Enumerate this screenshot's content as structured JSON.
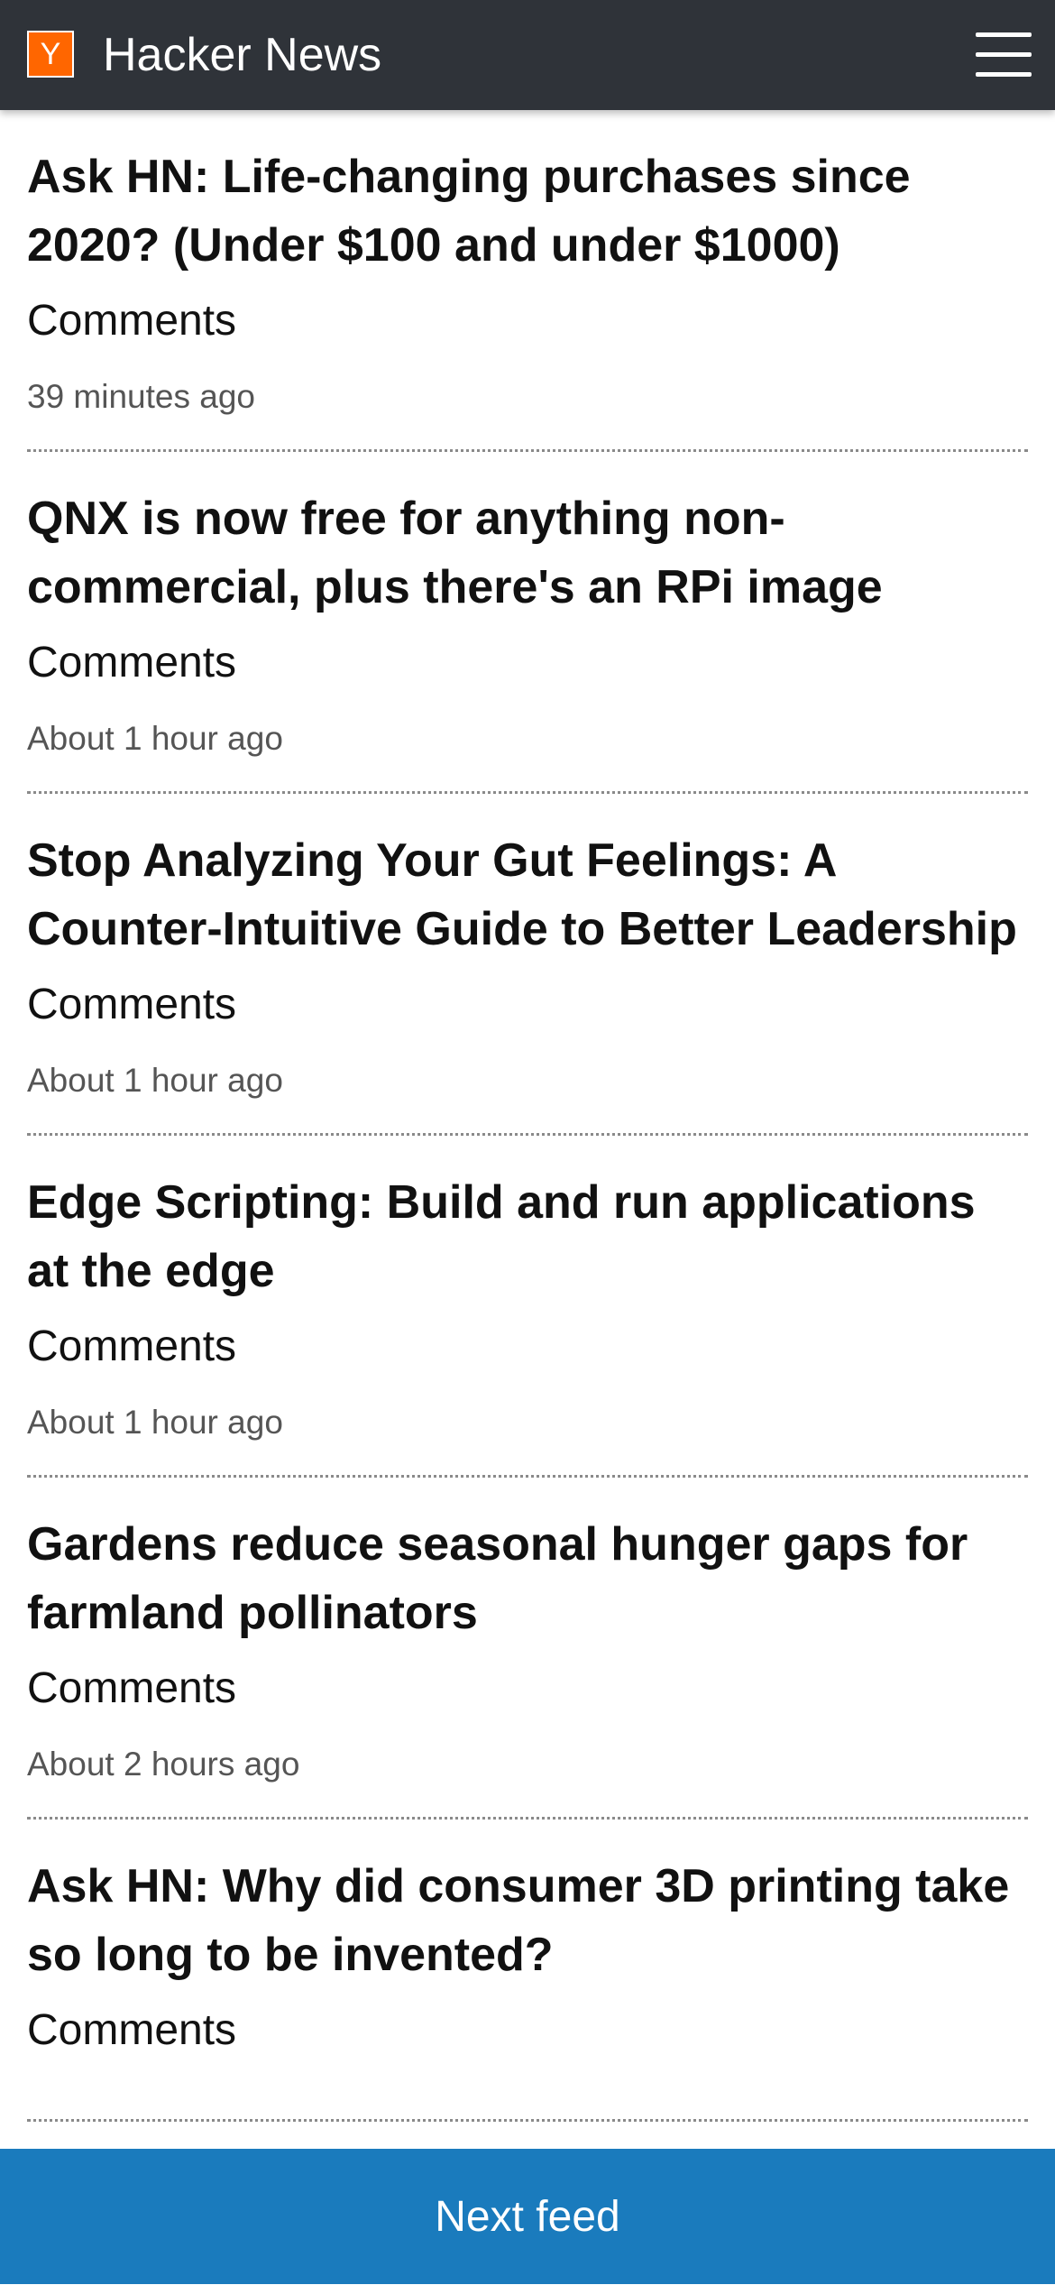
{
  "header": {
    "logo_letter": "Y",
    "title": "Hacker News",
    "menu_icon": "hamburger-menu-icon"
  },
  "stories": [
    {
      "title": "Ask HN: Life-changing purchases since 2020? (Under $100 and under $1000)",
      "comments_label": "Comments",
      "time": "39 minutes ago"
    },
    {
      "title": "QNX is now free for anything non-commercial, plus there's an RPi image",
      "comments_label": "Comments",
      "time": "About 1 hour ago"
    },
    {
      "title": "Stop Analyzing Your Gut Feelings: A Counter-Intuitive Guide to Better Leadership",
      "comments_label": "Comments",
      "time": "About 1 hour ago"
    },
    {
      "title": "Edge Scripting: Build and run applications at the edge",
      "comments_label": "Comments",
      "time": "About 1 hour ago"
    },
    {
      "title": "Gardens reduce seasonal hunger gaps for farmland pollinators",
      "comments_label": "Comments",
      "time": "About 2 hours ago"
    },
    {
      "title": "Ask HN: Why did consumer 3D printing take so long to be invented?",
      "comments_label": "Comments",
      "time": ""
    }
  ],
  "footer": {
    "next_feed_label": "Next feed"
  },
  "colors": {
    "header_bg": "#2f3339",
    "logo_bg": "#ff6600",
    "footer_button_bg": "#1a7bbd",
    "divider": "#8a8a8a"
  }
}
